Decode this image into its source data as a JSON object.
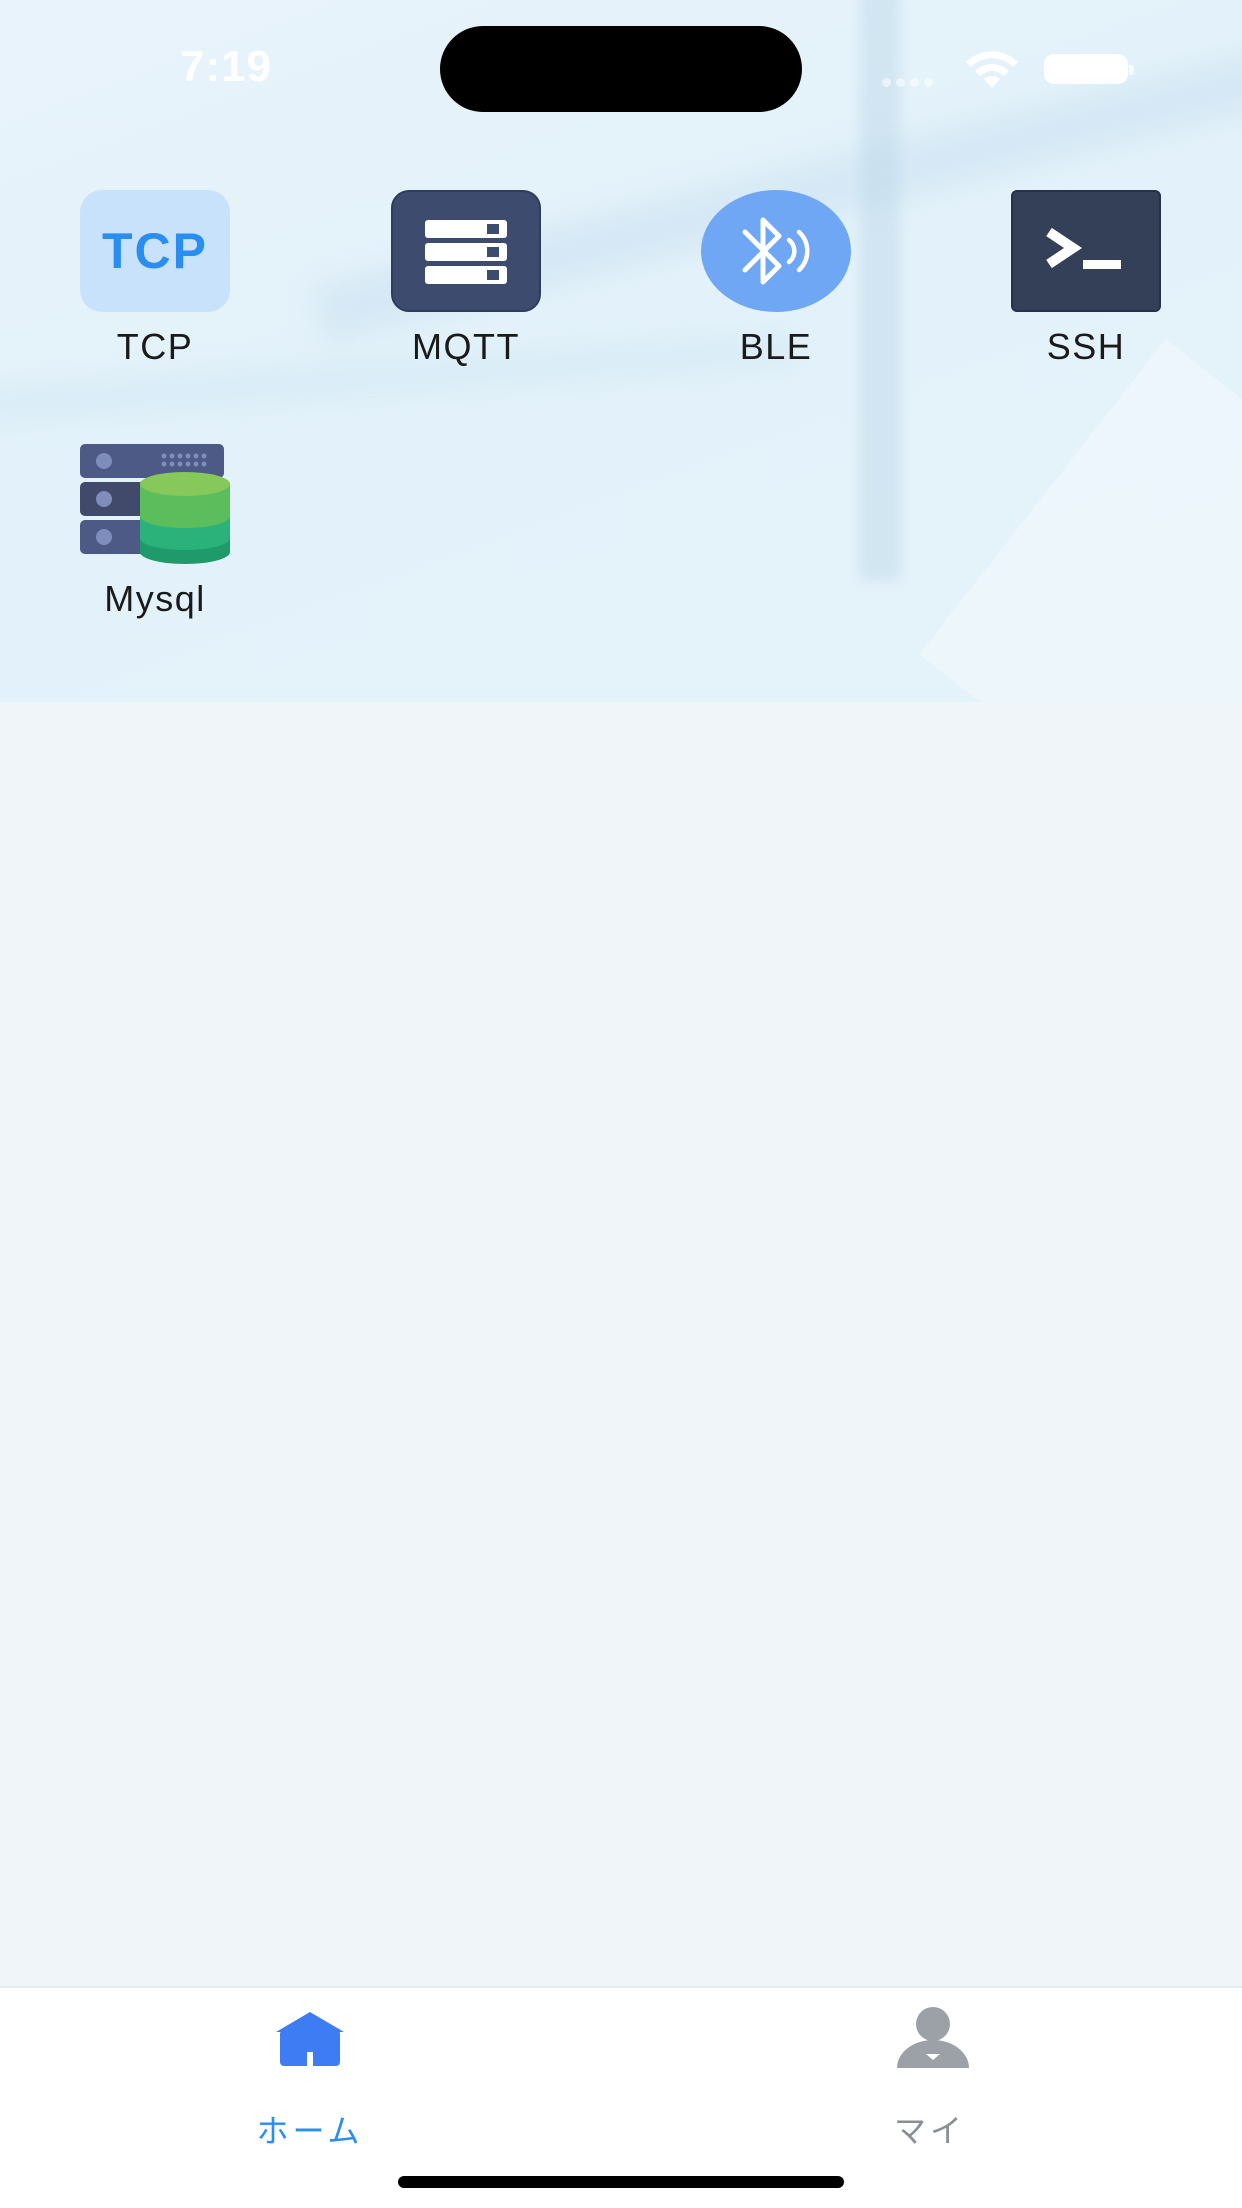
{
  "status_bar": {
    "time": "7:19",
    "wifi_icon": "wifi-icon",
    "battery_icon": "battery-icon"
  },
  "apps": [
    {
      "label": "TCP",
      "icon": "tcp-icon",
      "icon_text": "TCP",
      "color": "#2a8ef0"
    },
    {
      "label": "MQTT",
      "icon": "server-icon",
      "color": "#3c4b6e"
    },
    {
      "label": "BLE",
      "icon": "bluetooth-icon",
      "color": "#6fa7f5"
    },
    {
      "label": "SSH",
      "icon": "terminal-icon",
      "color": "#334058"
    },
    {
      "label": "Mysql",
      "icon": "database-icon",
      "color": "#2bb27a"
    }
  ],
  "tab_bar": {
    "items": [
      {
        "label": "ホーム",
        "icon": "home-icon",
        "active": true,
        "color": "#2a8ef0"
      },
      {
        "label": "マイ",
        "icon": "user-icon",
        "active": false,
        "color": "#8a8f96"
      }
    ]
  }
}
